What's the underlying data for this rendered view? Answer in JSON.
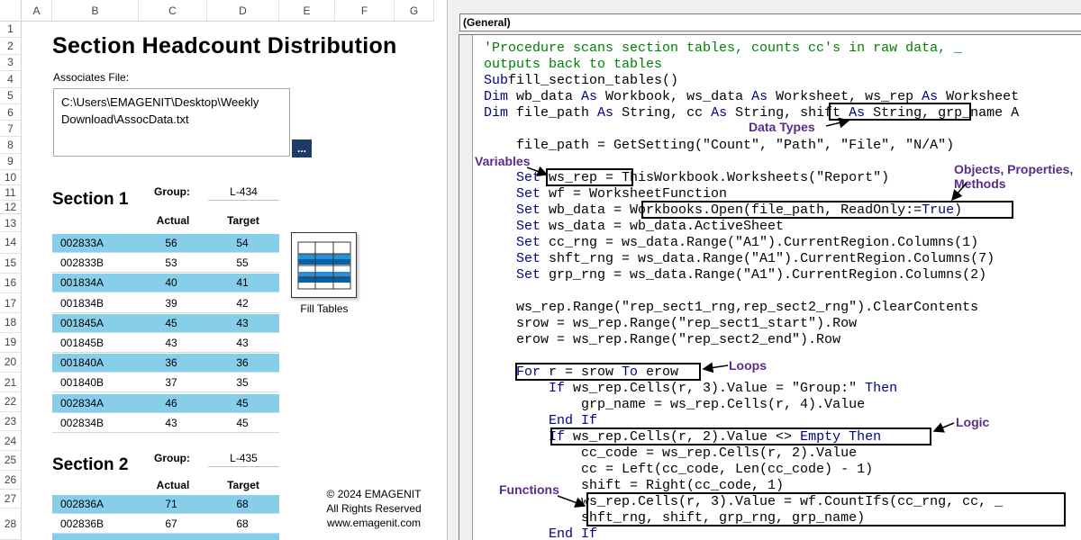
{
  "spreadsheet": {
    "columns": [
      "A",
      "B",
      "C",
      "D",
      "E",
      "F",
      "G"
    ],
    "rows": [
      "1",
      "2",
      "3",
      "4",
      "5",
      "6",
      "7",
      "8",
      "9",
      "10",
      "11",
      "12",
      "13",
      "14",
      "15",
      "16",
      "17",
      "18",
      "19",
      "20",
      "21",
      "22",
      "23",
      "24",
      "25",
      "26",
      "27",
      "28"
    ],
    "title": "Section Headcount Distribution",
    "associates_label": "Associates File:",
    "file_path_line1": "C:\\Users\\EMAGENIT\\Desktop\\Weekly",
    "file_path_line2": "Download\\AssocData.txt",
    "browse_label": "...",
    "sections": [
      {
        "title": "Section 1",
        "group_label": "Group:",
        "group_value": "L-434",
        "actual_header": "Actual",
        "target_header": "Target",
        "rows": [
          {
            "id": "002833A",
            "actual": "56",
            "target": "54"
          },
          {
            "id": "002833B",
            "actual": "53",
            "target": "55"
          },
          {
            "id": "001834A",
            "actual": "40",
            "target": "41"
          },
          {
            "id": "001834B",
            "actual": "39",
            "target": "42"
          },
          {
            "id": "001845A",
            "actual": "45",
            "target": "43"
          },
          {
            "id": "001845B",
            "actual": "43",
            "target": "43"
          },
          {
            "id": "001840A",
            "actual": "36",
            "target": "36"
          },
          {
            "id": "001840B",
            "actual": "37",
            "target": "35"
          },
          {
            "id": "002834A",
            "actual": "46",
            "target": "45"
          },
          {
            "id": "002834B",
            "actual": "43",
            "target": "45"
          }
        ]
      },
      {
        "title": "Section 2",
        "group_label": "Group:",
        "group_value": "L-435",
        "actual_header": "Actual",
        "target_header": "Target",
        "rows": [
          {
            "id": "002836A",
            "actual": "71",
            "target": "68"
          },
          {
            "id": "002836B",
            "actual": "67",
            "target": "68"
          }
        ]
      }
    ],
    "fill_tables_label": "Fill Tables",
    "copyright": [
      "© 2024 EMAGENIT",
      "All Rights Reserved",
      "www.emagenit.com"
    ],
    "row_band_color": "#87ceeb"
  },
  "editor": {
    "object_combo": "(General)",
    "code_lines": [
      [
        [
          "cm",
          "'Procedure scans section tables, counts cc's in raw data, _"
        ]
      ],
      [
        [
          "cm",
          "outputs back to tables"
        ]
      ],
      [
        [
          "kw",
          "Sub"
        ],
        [
          "",
          "fill_section_tables()"
        ]
      ],
      [
        [
          "kw",
          "Dim"
        ],
        [
          "",
          " wb_data "
        ],
        [
          "kw",
          "As"
        ],
        [
          "",
          " Workbook, ws_data "
        ],
        [
          "kw",
          "As"
        ],
        [
          "",
          " Worksheet, ws_rep "
        ],
        [
          "kw",
          "As"
        ],
        [
          "",
          " Worksheet"
        ]
      ],
      [
        [
          "kw",
          "Dim"
        ],
        [
          "",
          " file_path "
        ],
        [
          "kw",
          "As"
        ],
        [
          "",
          " String, cc "
        ],
        [
          "kw",
          "As"
        ],
        [
          "",
          " String, shift "
        ],
        [
          "kw",
          "As"
        ],
        [
          "",
          " String, grp_name A"
        ]
      ],
      [],
      [
        [
          "",
          "    file_path = GetSetting(\"Count\", \"Path\", \"File\", \"N/A\")"
        ]
      ],
      [],
      [
        [
          "kw",
          "    Set"
        ],
        [
          "",
          " ws_rep = ThisWorkbook.Worksheets(\"Report\")"
        ]
      ],
      [
        [
          "kw",
          "    Set"
        ],
        [
          "",
          " wf = WorksheetFunction"
        ]
      ],
      [
        [
          "kw",
          "    Set"
        ],
        [
          "",
          " wb_data = Workbooks.Open(file_path, ReadOnly:="
        ],
        [
          "kw",
          "True"
        ],
        [
          "",
          ")"
        ]
      ],
      [
        [
          "kw",
          "    Set"
        ],
        [
          "",
          " ws_data = wb_data.ActiveSheet"
        ]
      ],
      [
        [
          "kw",
          "    Set"
        ],
        [
          "",
          " cc_rng = ws_data.Range(\"A1\").CurrentRegion.Columns(1)"
        ]
      ],
      [
        [
          "kw",
          "    Set"
        ],
        [
          "",
          " shft_rng = ws_data.Range(\"A1\").CurrentRegion.Columns(7)"
        ]
      ],
      [
        [
          "kw",
          "    Set"
        ],
        [
          "",
          " grp_rng = ws_data.Range(\"A1\").CurrentRegion.Columns(2)"
        ]
      ],
      [],
      [
        [
          "",
          "    ws_rep.Range(\"rep_sect1_rng,rep_sect2_rng\").ClearContents"
        ]
      ],
      [
        [
          "",
          "    srow = ws_rep.Range(\"rep_sect1_start\").Row"
        ]
      ],
      [
        [
          "",
          "    erow = ws_rep.Range(\"rep_sect2_end\").Row"
        ]
      ],
      [],
      [
        [
          "kw",
          "    For"
        ],
        [
          "",
          " r = srow "
        ],
        [
          "kw",
          "To"
        ],
        [
          "",
          " erow"
        ]
      ],
      [
        [
          "kw",
          "        If"
        ],
        [
          "",
          " ws_rep.Cells(r, 3).Value = \"Group:\" "
        ],
        [
          "kw",
          "Then"
        ]
      ],
      [
        [
          "",
          "            grp_name = ws_rep.Cells(r, 4).Value"
        ]
      ],
      [
        [
          "kw",
          "        End If"
        ]
      ],
      [
        [
          "kw",
          "        If"
        ],
        [
          "",
          " ws_rep.Cells(r, 2).Value <> "
        ],
        [
          "kw",
          "Empty Then"
        ]
      ],
      [
        [
          "",
          "            cc_code = ws_rep.Cells(r, 2).Value"
        ]
      ],
      [
        [
          "",
          "            cc = Left(cc_code, Len(cc_code) - 1)"
        ]
      ],
      [
        [
          "",
          "            shift = Right(cc_code, 1)"
        ]
      ],
      [
        [
          "",
          "            ws_rep.Cells(r, 3).Value = wf.CountIfs(cc_rng, cc, _"
        ]
      ],
      [
        [
          "",
          "            shft_rng, shift, grp_rng, grp_name)"
        ]
      ],
      [
        [
          "kw",
          "        End If"
        ]
      ]
    ],
    "annotations": {
      "data_types": "Data Types",
      "variables": "Variables",
      "objects_line1": "Objects, Properties,",
      "objects_line2": "Methods",
      "loops": "Loops",
      "logic": "Logic",
      "functions": "Functions"
    },
    "keyword_color": "#00008b",
    "comment_color": "#008000",
    "annotation_color": "#5b2a8c"
  }
}
